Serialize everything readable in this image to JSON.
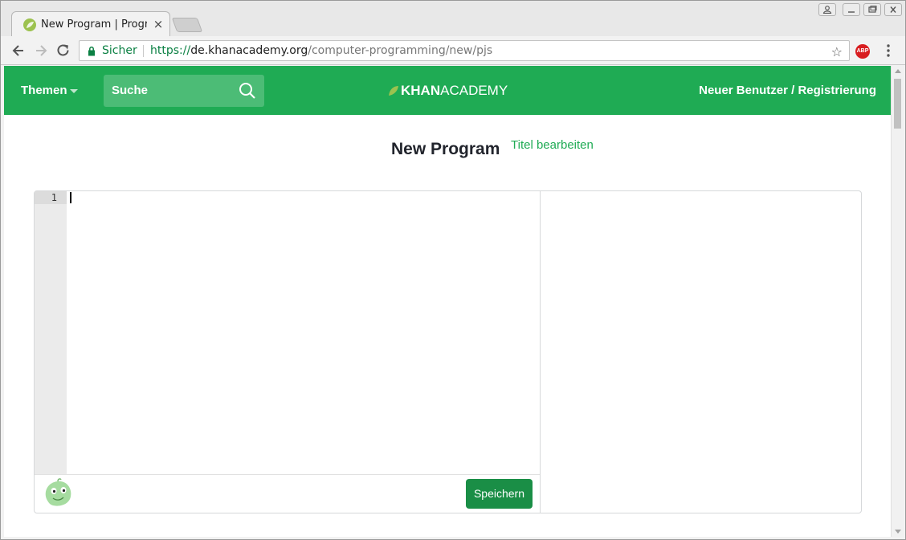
{
  "browser": {
    "tab_title": "New Program | Program",
    "tab_close": "×",
    "secure_label": "Sicher",
    "url_scheme": "https://",
    "url_host": "de.khanacademy.org",
    "url_path": "/computer-programming/new/pjs",
    "bookmark_icon": "star-icon",
    "extension_label": "ABP"
  },
  "header": {
    "topics_label": "Themen",
    "search_placeholder": "Suche",
    "logo_bold": "KHAN",
    "logo_light": "ACADEMY",
    "signup_label": "Neuer Benutzer / Registrierung"
  },
  "program": {
    "title": "New Program",
    "edit_title_label": "Titel bearbeiten"
  },
  "editor": {
    "line_numbers": [
      "1"
    ],
    "save_label": "Speichern"
  },
  "colors": {
    "brand_green": "#1fab54",
    "save_green": "#1a8e46",
    "secure_green": "#0b8043"
  }
}
